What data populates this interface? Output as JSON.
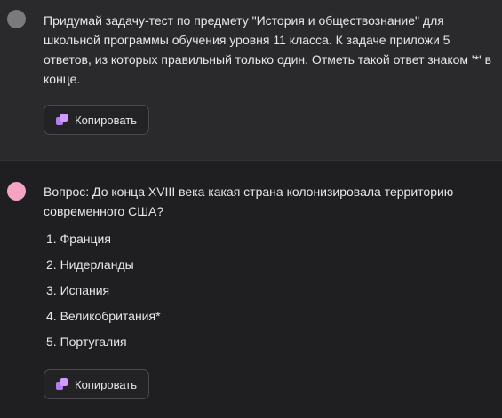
{
  "user_message": {
    "text": "Придумай задачу-тест по предмету \"История и обществознание\" для школьной программы обучения уровня 11 класса. К задаче приложи 5 ответов, из которых правильный только один. Отметь такой ответ знаком '*' в конце.",
    "copy_label": "Копировать"
  },
  "bot_message": {
    "question": "Вопрос: До конца XVIII века какая страна колонизировала территорию современного США?",
    "answers": [
      "1. Франция",
      "2. Нидерланды",
      "3. Испания",
      "4. Великобритания*",
      "5. Португалия"
    ],
    "copy_label": "Копировать"
  },
  "colors": {
    "user_bg": "#2a2a2c",
    "bot_bg": "#1f1f21",
    "bot_avatar": "#f4a3c4",
    "user_avatar": "#7a7a7a",
    "copy_icon": "#b27bf0"
  },
  "icons": {
    "copy": "copy-icon"
  }
}
